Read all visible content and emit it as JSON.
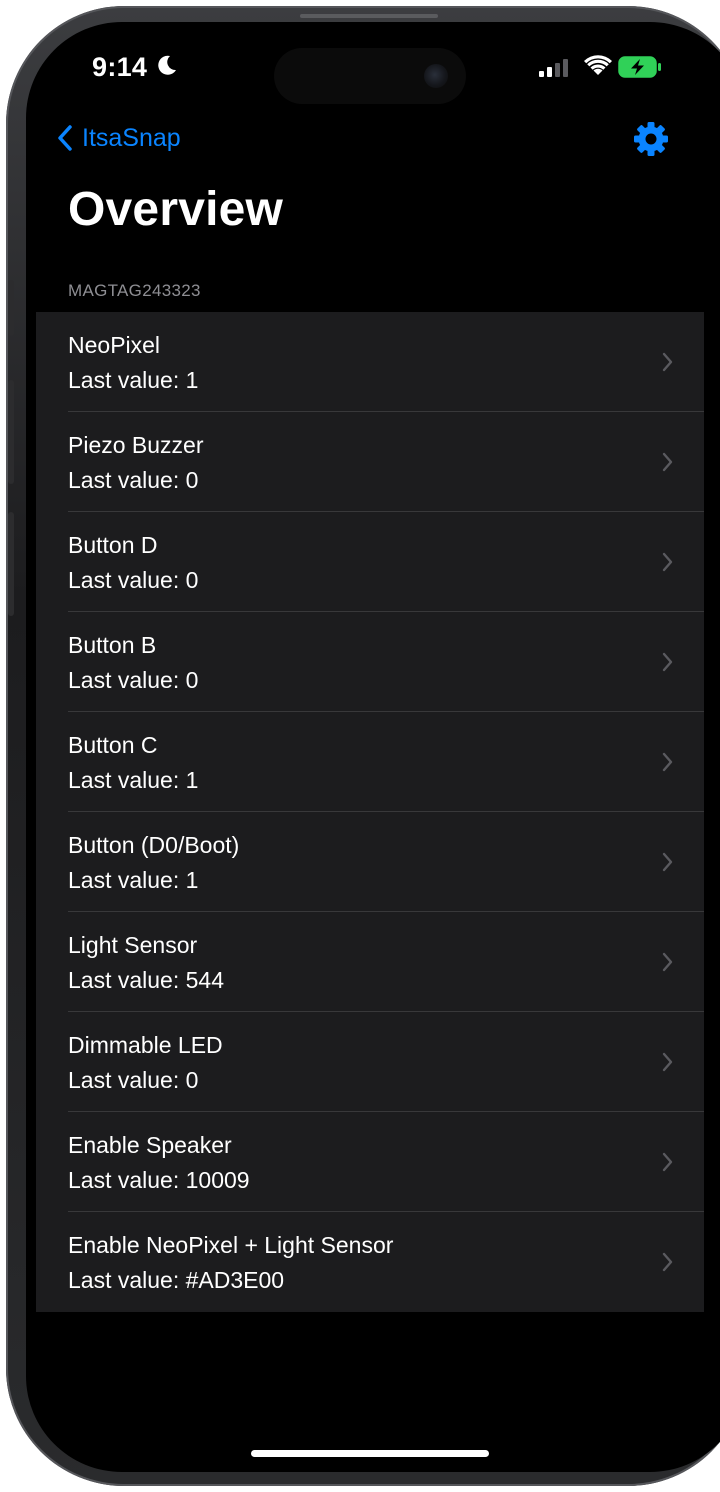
{
  "status_bar": {
    "time": "9:14",
    "focus_icon": "moon-icon",
    "signal_icon": "cellular-signal-icon",
    "wifi_icon": "wifi-icon",
    "battery_icon": "battery-charging-icon"
  },
  "nav": {
    "back_label": "ItsaSnap",
    "settings_icon": "gear-icon"
  },
  "page": {
    "title": "Overview",
    "section_header": "MAGTAG243323"
  },
  "items": [
    {
      "title": "NeoPixel",
      "subtitle": "Last value: 1"
    },
    {
      "title": "Piezo Buzzer",
      "subtitle": "Last value: 0"
    },
    {
      "title": "Button D",
      "subtitle": "Last value: 0"
    },
    {
      "title": "Button B",
      "subtitle": "Last value: 0"
    },
    {
      "title": "Button C",
      "subtitle": "Last value: 1"
    },
    {
      "title": "Button (D0/Boot)",
      "subtitle": "Last value: 1"
    },
    {
      "title": "Light Sensor",
      "subtitle": "Last value: 544"
    },
    {
      "title": "Dimmable LED",
      "subtitle": "Last value: 0"
    },
    {
      "title": "Enable Speaker",
      "subtitle": "Last value: 10009"
    },
    {
      "title": "Enable NeoPixel + Light Sensor",
      "subtitle": "Last value: #AD3E00"
    }
  ],
  "colors": {
    "accent": "#0a84ff",
    "background": "#000000",
    "cell_background": "#1c1c1e",
    "battery_charging": "#30d158"
  }
}
